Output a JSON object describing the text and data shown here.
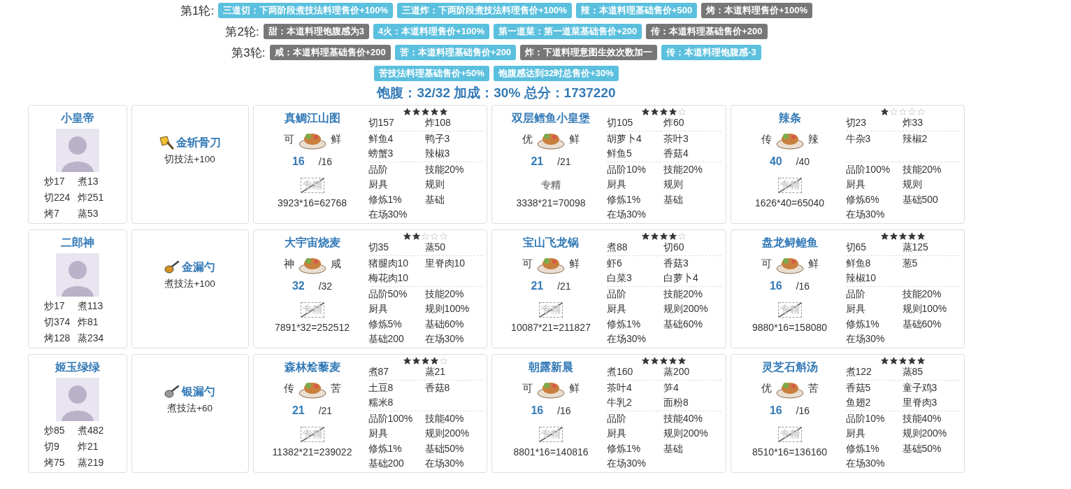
{
  "rounds": [
    {
      "label": "第1轮:",
      "tags": [
        {
          "text": "三道切：下两阶段煮技法料理售价+100%",
          "color": "#5bc0de"
        },
        {
          "text": "三道炸：下两阶段煮技法料理售价+100%",
          "color": "#5bc0de"
        },
        {
          "text": "辣：本道料理基础售价+500",
          "color": "#5bc0de"
        },
        {
          "text": "烤：本道料理售价+100%",
          "color": "#777777"
        }
      ]
    },
    {
      "label": "第2轮:",
      "tags": [
        {
          "text": "甜：本道料理饱腹感为3",
          "color": "#777777"
        },
        {
          "text": "4火：本道料理售价+100%",
          "color": "#5bc0de"
        },
        {
          "text": "第一道菜：第一道菜基础售价+200",
          "color": "#5bc0de"
        },
        {
          "text": "传：本道料理基础售价+200",
          "color": "#777777"
        }
      ]
    },
    {
      "label": "第3轮:",
      "tags": [
        {
          "text": "咸：本道料理基础售价+200",
          "color": "#777777"
        },
        {
          "text": "苦：本道料理基础售价+200",
          "color": "#5bc0de"
        },
        {
          "text": "炸：下道料理意图生效次数加一",
          "color": "#777777"
        },
        {
          "text": "传：本道料理饱腹感-3",
          "color": "#5bc0de"
        }
      ]
    },
    {
      "tags": [
        {
          "text": "苦技法料理基础售价+50%",
          "color": "#5bc0de"
        },
        {
          "text": "饱腹感达到32时总售价+30%",
          "color": "#5bc0de"
        }
      ]
    }
  ],
  "summary": "饱腹：32/32 加成：30% 总分：1737220",
  "rows": [
    {
      "chef": {
        "name": "小皇帝",
        "stats": [
          "炒17",
          "煮13",
          "切224",
          "炸251",
          "烤7",
          "蒸53"
        ]
      },
      "equipment": {
        "kind": "cleaver",
        "name": "金斩骨刀",
        "effect": "切技法+100"
      },
      "recipes": [
        {
          "name": "真鲷江山图",
          "rank": "可",
          "taste": "鲜",
          "count": "16",
          "limit": "/16",
          "mastery": {
            "label": "专精",
            "active": false
          },
          "formula": "3923*16=62768",
          "stars": 5,
          "skills": [
            "切157",
            "炸108"
          ],
          "ingredients": [
            "鲜鱼4",
            "鸭子3",
            "螃蟹3",
            "辣椒3"
          ],
          "buffs": [
            "品阶",
            "技能20%",
            "厨具",
            "规则",
            "修炼1%",
            "基础",
            "在场30%"
          ]
        },
        {
          "name": "双层鳕鱼小皇堡",
          "rank": "优",
          "taste": "鲜",
          "count": "21",
          "limit": "/21",
          "mastery": {
            "label": "专精",
            "active": true
          },
          "formula": "3338*21=70098",
          "stars": 4,
          "skills": [
            "切105",
            "炸60"
          ],
          "ingredients": [
            "胡萝卜4",
            "茶叶3",
            "鲜鱼5",
            "香菇4"
          ],
          "buffs": [
            "品阶10%",
            "技能20%",
            "厨具",
            "规则",
            "修炼1%",
            "基础",
            "在场30%"
          ]
        },
        {
          "name": "辣条",
          "rank": "传",
          "taste": "辣",
          "count": "40",
          "limit": "/40",
          "mastery": {
            "label": "专精",
            "active": false
          },
          "formula": "1626*40=65040",
          "stars": 1,
          "skills": [
            "切23",
            "炸33"
          ],
          "ingredients": [
            "牛杂3",
            "辣椒2"
          ],
          "buffs": [
            "品阶100%",
            "技能20%",
            "厨具",
            "规则",
            "修炼6%",
            "基础500",
            "在场30%"
          ]
        }
      ]
    },
    {
      "chef": {
        "name": "二郎神",
        "stats": [
          "炒17",
          "煮113",
          "切374",
          "炸81",
          "烤128",
          "蒸234"
        ]
      },
      "equipment": {
        "kind": "gold-ladle",
        "name": "金漏勺",
        "effect": "煮技法+100"
      },
      "recipes": [
        {
          "name": "大宇宙烧麦",
          "rank": "神",
          "taste": "咸",
          "count": "32",
          "limit": "/32",
          "mastery": {
            "label": "专精",
            "active": false
          },
          "formula": "7891*32=252512",
          "stars": 2,
          "skills": [
            "切35",
            "蒸50"
          ],
          "ingredients": [
            "猪腿肉10",
            "里脊肉10",
            "梅花肉10"
          ],
          "buffs": [
            "品阶50%",
            "技能20%",
            "厨具",
            "规则100%",
            "修炼5%",
            "基础60%",
            "基础200",
            "在场30%"
          ]
        },
        {
          "name": "宝山飞龙锅",
          "rank": "可",
          "taste": "鲜",
          "count": "21",
          "limit": "/21",
          "mastery": {
            "label": "专精",
            "active": false
          },
          "formula": "10087*21=211827",
          "stars": 4,
          "skills": [
            "煮88",
            "切60"
          ],
          "ingredients": [
            "虾6",
            "香菇3",
            "白菜3",
            "白萝卜4"
          ],
          "buffs": [
            "品阶",
            "技能20%",
            "厨具",
            "规则200%",
            "修炼1%",
            "基础60%",
            "在场30%"
          ]
        },
        {
          "name": "盘龙鲟鳇鱼",
          "rank": "可",
          "taste": "鲜",
          "count": "16",
          "limit": "/16",
          "mastery": {
            "label": "专精",
            "active": false
          },
          "formula": "9880*16=158080",
          "stars": 5,
          "skills": [
            "切65",
            "蒸125"
          ],
          "ingredients": [
            "鲜鱼8",
            "葱5",
            "辣椒10"
          ],
          "buffs": [
            "品阶",
            "技能20%",
            "厨具",
            "规则100%",
            "修炼1%",
            "基础60%",
            "在场30%"
          ]
        }
      ]
    },
    {
      "chef": {
        "name": "姬玉绿绿",
        "stats": [
          "炒85",
          "煮482",
          "切9",
          "炸21",
          "烤75",
          "蒸219"
        ]
      },
      "equipment": {
        "kind": "silver-ladle",
        "name": "银漏勺",
        "effect": "煮技法+60"
      },
      "recipes": [
        {
          "name": "森林烩藜麦",
          "rank": "传",
          "taste": "苦",
          "count": "21",
          "limit": "/21",
          "mastery": {
            "label": "专精",
            "active": false
          },
          "formula": "11382*21=239022",
          "stars": 4,
          "skills": [
            "煮87",
            "蒸21"
          ],
          "ingredients": [
            "土豆8",
            "香菇8",
            "糯米8"
          ],
          "buffs": [
            "品阶100%",
            "技能40%",
            "厨具",
            "规则200%",
            "修炼1%",
            "基础50%",
            "基础200",
            "在场30%"
          ]
        },
        {
          "name": "朝露新晨",
          "rank": "可",
          "taste": "鲜",
          "count": "16",
          "limit": "/16",
          "mastery": {
            "label": "专精",
            "active": false
          },
          "formula": "8801*16=140816",
          "stars": 5,
          "skills": [
            "煮160",
            "蒸200"
          ],
          "ingredients": [
            "茶叶4",
            "笋4",
            "牛乳2",
            "面粉8"
          ],
          "buffs": [
            "品阶",
            "技能40%",
            "厨具",
            "规则200%",
            "修炼1%",
            "基础",
            "在场30%"
          ]
        },
        {
          "name": "灵芝石斛汤",
          "rank": "优",
          "taste": "苦",
          "count": "16",
          "limit": "/16",
          "mastery": {
            "label": "专精",
            "active": false
          },
          "formula": "8510*16=136160",
          "stars": 5,
          "skills": [
            "煮122",
            "蒸85"
          ],
          "ingredients": [
            "香菇5",
            "童子鸡3",
            "鱼翅2",
            "里脊肉3"
          ],
          "buffs": [
            "品阶10%",
            "技能40%",
            "厨具",
            "规则200%",
            "修炼1%",
            "基础50%",
            "在场30%"
          ]
        }
      ]
    }
  ]
}
